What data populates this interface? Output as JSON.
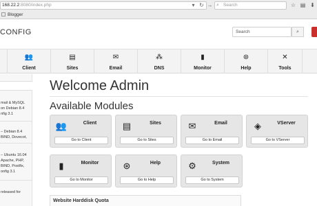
{
  "browser": {
    "url_host": "168.22.2",
    "url_rest": ":8080/index.php",
    "search_placeholder": "Search",
    "bookmark_label": "Blogger"
  },
  "app": {
    "logo_text": "CONFIG",
    "search_placeholder": "Search",
    "nav": [
      {
        "label": "Client",
        "icon": "client-icon"
      },
      {
        "label": "Sites",
        "icon": "sites-icon"
      },
      {
        "label": "Email",
        "icon": "email-icon"
      },
      {
        "label": "DNS",
        "icon": "dns-icon"
      },
      {
        "label": "Monitor",
        "icon": "monitor-icon"
      },
      {
        "label": "Help",
        "icon": "help-icon"
      },
      {
        "label": "Tools",
        "icon": "tools-icon"
      }
    ]
  },
  "sidebar": {
    "blocks": [
      [
        "mail & MySQL",
        "on Debian 8.4",
        "nfig 3.1"
      ],
      [
        "– Debian 8.4",
        "BIND, Dovecot,"
      ],
      [
        "– Ubuntu 16.04",
        "Apache, PHP,",
        "BIND, Postfix,",
        "onfig 3.1"
      ],
      [
        "released for"
      ]
    ]
  },
  "main": {
    "welcome": "Welcome Admin",
    "modules_title": "Available Modules",
    "modules": [
      {
        "title": "Client",
        "button": "Go to Client",
        "icon": "client-icon"
      },
      {
        "title": "Sites",
        "button": "Go to Sites",
        "icon": "sites-icon"
      },
      {
        "title": "Email",
        "button": "Go to Email",
        "icon": "email-icon"
      },
      {
        "title": "VServer",
        "button": "Go to VServer",
        "icon": "vserver-icon"
      },
      {
        "title": "Monitor",
        "button": "Go to Monitor",
        "icon": "monitor-icon"
      },
      {
        "title": "Help",
        "button": "Go to Help",
        "icon": "help-icon"
      },
      {
        "title": "System",
        "button": "Go to System",
        "icon": "system-icon"
      }
    ],
    "quota_title": "Website Harddisk Quota"
  }
}
